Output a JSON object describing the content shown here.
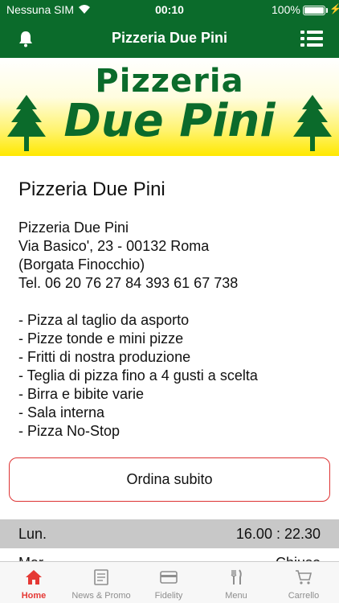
{
  "status_bar": {
    "carrier": "Nessuna SIM",
    "time": "00:10",
    "battery": "100%",
    "battery_level": 1.0
  },
  "nav": {
    "title": "Pizzeria Due Pini"
  },
  "banner": {
    "line1": "Pizzeria",
    "line2": "Due Pini"
  },
  "main": {
    "heading": "Pizzeria Due Pini",
    "address": [
      "Pizzeria Due Pini",
      "Via Basico', 23 - 00132 Roma",
      "(Borgata Finocchio)",
      "Tel. 06 20 76 27 84  393 61 67 738"
    ],
    "features": [
      "- Pizza al taglio da asporto",
      "- Pizze tonde e mini pizze",
      "- Fritti di nostra produzione",
      "- Teglia di pizza fino a 4 gusti a scelta",
      "- Birra e bibite varie",
      "- Sala interna",
      "- Pizza No-Stop"
    ],
    "order_button": "Ordina subito"
  },
  "hours": [
    {
      "day": "Lun.",
      "time": "16.00 : 22.30"
    },
    {
      "day": "Mar.",
      "time": "Chiuso"
    }
  ],
  "tabs": [
    {
      "label": "Home",
      "icon": "home-icon"
    },
    {
      "label": "News & Promo",
      "icon": "news-icon"
    },
    {
      "label": "Fidelity",
      "icon": "card-icon"
    },
    {
      "label": "Menu",
      "icon": "cutlery-icon"
    },
    {
      "label": "Carrello",
      "icon": "cart-icon"
    }
  ],
  "colors": {
    "brand_green": "#0b6b2b",
    "accent_red": "#e53935",
    "banner_yellow": "#ffe800"
  }
}
